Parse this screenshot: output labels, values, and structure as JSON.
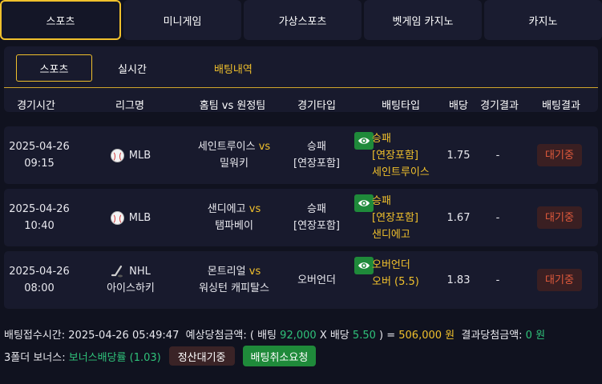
{
  "top_tabs": [
    "스포츠",
    "미니게임",
    "가상스포츠",
    "벳게임 카지노",
    "카지노"
  ],
  "sub_tabs": [
    "스포츠",
    "실시간",
    "배팅내역"
  ],
  "columns": [
    "경기시간",
    "리그명",
    "홈팀 vs 원정팀",
    "경기타입",
    "배팅타입",
    "배당",
    "경기결과",
    "배팅결과"
  ],
  "rows": [
    {
      "date": "2025-04-26",
      "time": "09:15",
      "league_icon": "baseball-icon",
      "league": "MLB",
      "league_sub": "",
      "home": "세인트루이스",
      "vs": "vs",
      "away": "밀워키",
      "game_type": "승패",
      "game_type_sub": "[연장포함]",
      "bet_line1": "승패",
      "bet_line2": "[연장포함]",
      "bet_line3": "세인트루이스",
      "odds": "1.75",
      "game_result": "-",
      "bet_result": "대기중"
    },
    {
      "date": "2025-04-26",
      "time": "10:40",
      "league_icon": "baseball-icon",
      "league": "MLB",
      "league_sub": "",
      "home": "샌디에고",
      "vs": "vs",
      "away": "탬파베이",
      "game_type": "승패",
      "game_type_sub": "[연장포함]",
      "bet_line1": "승패",
      "bet_line2": "[연장포함]",
      "bet_line3": "샌디에고",
      "odds": "1.67",
      "game_result": "-",
      "bet_result": "대기중"
    },
    {
      "date": "2025-04-26",
      "time": "08:00",
      "league_icon": "hockey-icon",
      "league": "NHL",
      "league_sub": "아이스하키",
      "home": "몬트리얼",
      "vs": "vs",
      "away": "워싱턴 캐피탈스",
      "game_type": "오버언더",
      "game_type_sub": "",
      "bet_line1": "오버언더",
      "bet_line2": "오버 (5.5)",
      "bet_line3": "",
      "odds": "1.83",
      "game_result": "-",
      "bet_result": "대기중"
    }
  ],
  "footer": {
    "bet_time_label": "배팅접수시간:",
    "bet_time": "2025-04-26 05:49:47",
    "expected_label": "예상당첨금액: ( 배팅",
    "stake": "92,000",
    "x_label": "X 배당",
    "total_odds": "5.50",
    "paren_eq": ") =",
    "expected_amount": "506,000 원",
    "result_label": "결과당첨금액:",
    "result_amount": "0 원",
    "bonus_label": "3폴더 보너스:",
    "bonus_value": "보너스배당률 (1.03)",
    "settle_button": "정산대기중",
    "cancel_button": "배팅취소요청"
  },
  "colors": {
    "accent": "#f0c02c",
    "green": "#1f8a3a",
    "pending": "#e25a3c",
    "background": "#10121f"
  }
}
